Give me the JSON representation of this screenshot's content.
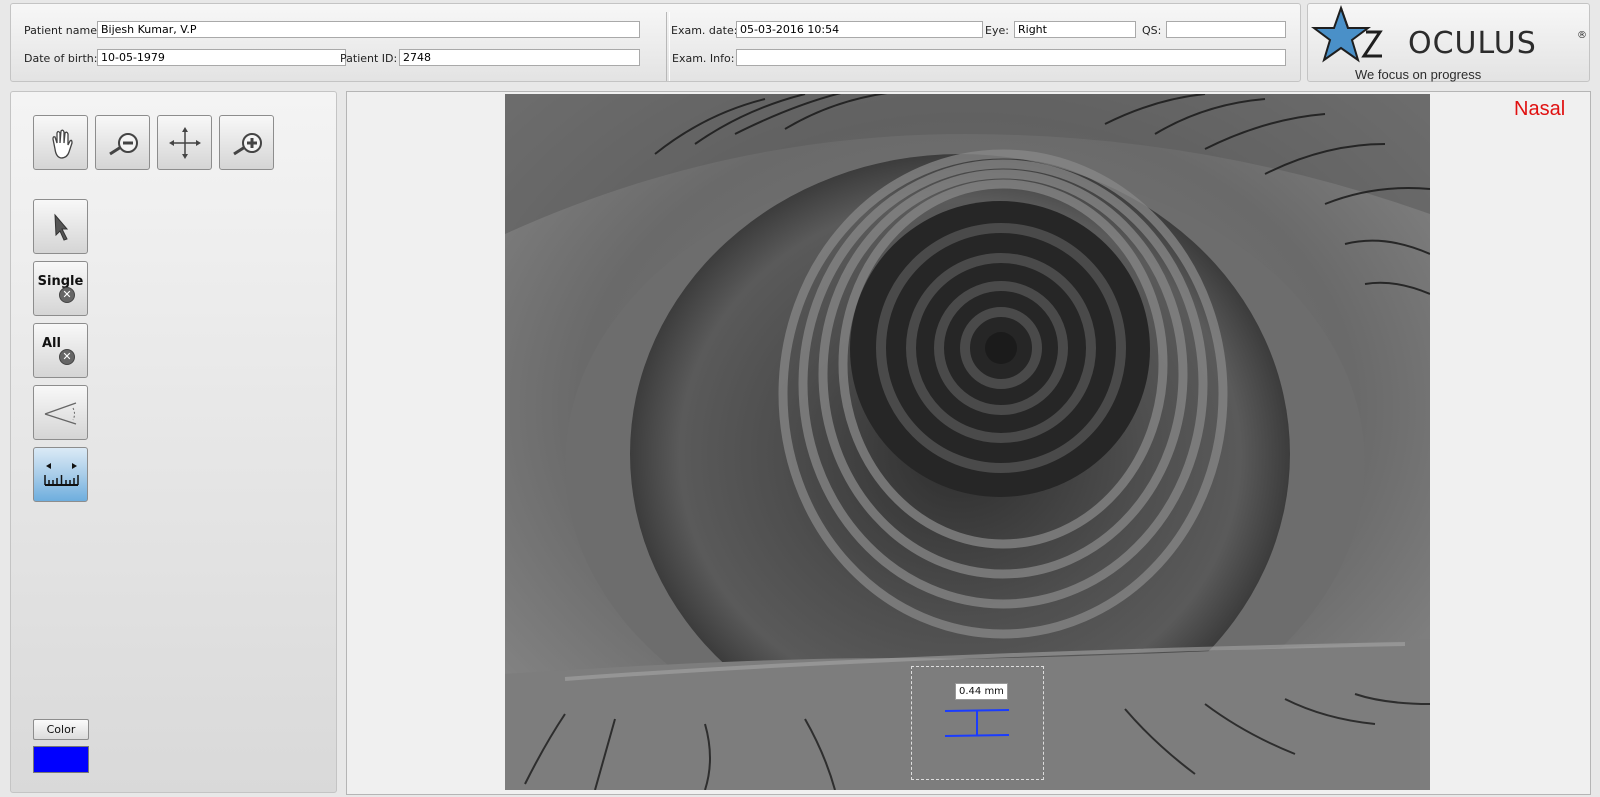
{
  "header": {
    "patient_name_label": "Patient name:",
    "patient_name": "Bijesh Kumar, V.P",
    "dob_label": "Date of birth:",
    "dob": "10-05-1979",
    "patient_id_label": "Patient ID:",
    "patient_id": "2748",
    "exam_date_label": "Exam. date:",
    "exam_date": "05-03-2016 10:54",
    "eye_label": "Eye:",
    "eye": "Right",
    "qs_label": "QS:",
    "qs": "",
    "exam_info_label": "Exam. Info:",
    "exam_info": ""
  },
  "logo": {
    "brand": "OCULUS",
    "registered": "®",
    "tagline": "We focus on progress",
    "star_color": "#4a90c8"
  },
  "toolbar": {
    "tools": [
      {
        "name": "pan",
        "icon": "hand-icon"
      },
      {
        "name": "zoom-out",
        "icon": "zoom-out-icon"
      },
      {
        "name": "fit",
        "icon": "move-arrows-icon"
      },
      {
        "name": "zoom-in",
        "icon": "zoom-in-icon"
      },
      {
        "name": "select",
        "icon": "arrow-pointer-icon"
      },
      {
        "name": "delete-single",
        "icon": "delete-icon"
      },
      {
        "name": "delete-all",
        "icon": "delete-icon"
      },
      {
        "name": "angle",
        "icon": "angle-icon"
      },
      {
        "name": "ruler",
        "icon": "ruler-icon",
        "active": true
      }
    ],
    "single_label": "Single",
    "all_label": "All",
    "color_label": "Color",
    "selected_color": "#0000ff"
  },
  "viewer": {
    "orientation_label": "Nasal",
    "orientation_color": "#e01010",
    "measurement": {
      "value_label": "0.44 mm",
      "line_color": "#1a3cff"
    }
  }
}
